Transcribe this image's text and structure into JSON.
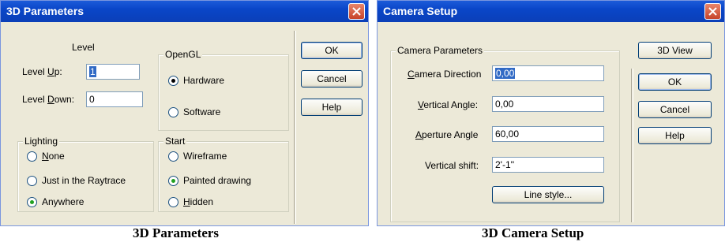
{
  "left_dialog": {
    "title": "3D Parameters",
    "level": {
      "heading": "Level",
      "up_label": "Level Up:",
      "up_value": "1",
      "down_label": "Level Down:",
      "down_value": "0"
    },
    "opengl": {
      "legend": "OpenGL",
      "hardware": "Hardware",
      "software": "Software",
      "selected": "Hardware"
    },
    "lighting": {
      "legend": "Lighting",
      "none": "None",
      "raytrace": "Just in the Raytrace",
      "anywhere": "Anywhere",
      "selected": "Anywhere"
    },
    "start": {
      "legend": "Start",
      "wireframe": "Wireframe",
      "painted": "Painted drawing",
      "hidden": "Hidden",
      "selected": "Painted drawing"
    },
    "buttons": {
      "ok": "OK",
      "cancel": "Cancel",
      "help": "Help"
    }
  },
  "right_dialog": {
    "title": "Camera Setup",
    "camera": {
      "legend": "Camera Parameters",
      "direction_label": "Camera Direction",
      "direction_value": "0,00",
      "vertical_angle_label": "Vertical Angle:",
      "vertical_angle_value": "0,00",
      "aperture_label": "Aperture Angle",
      "aperture_value": "60,00",
      "vertical_shift_label": "Vertical shift:",
      "vertical_shift_value": "2'-1''",
      "line_style_button": "Line style..."
    },
    "buttons": {
      "view3d": "3D View",
      "ok": "OK",
      "cancel": "Cancel",
      "help": "Help"
    }
  },
  "captions": {
    "left": "3D Parameters",
    "right": "3D Camera Setup"
  },
  "colors": {
    "titlebar": "#0a46c8",
    "dialog_bg": "#ece9d8",
    "close_button": "#c7442a",
    "selection": "#316ac5",
    "radio_dot": "#21a121"
  }
}
